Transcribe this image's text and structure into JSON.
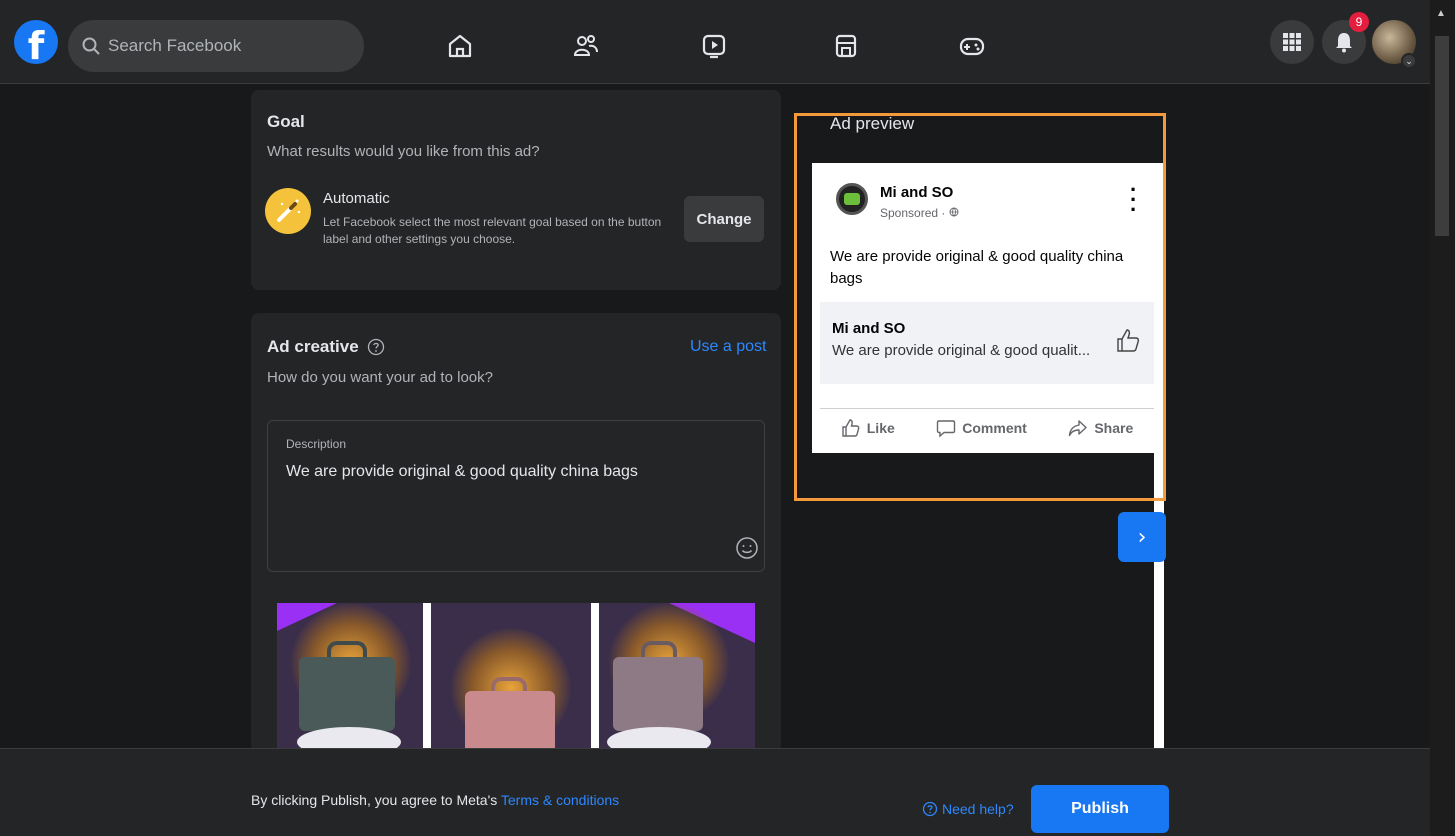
{
  "topbar": {
    "search_placeholder": "Search Facebook",
    "notification_count": "9",
    "nav_icons": [
      "home-icon",
      "friends-icon",
      "watch-icon",
      "marketplace-icon",
      "gaming-icon"
    ]
  },
  "goal": {
    "title": "Goal",
    "subtitle": "What results would you like from this ad?",
    "option_title": "Automatic",
    "option_desc": "Let Facebook select the most relevant goal based on the button label and other settings you choose.",
    "change_label": "Change"
  },
  "creative": {
    "title": "Ad creative",
    "subtitle": "How do you want your ad to look?",
    "use_post_label": "Use a post",
    "description_label": "Description",
    "description_value": "We are provide original & good quality china bags"
  },
  "preview": {
    "title": "Ad preview",
    "page_name": "Mi and SO",
    "sponsored": "Sponsored · ",
    "post_text": "We are provide original & good quality china bags",
    "link_title": "Mi and SO",
    "link_desc": "We are provide original & good qualit...",
    "actions": {
      "like": "Like",
      "comment": "Comment",
      "share": "Share"
    },
    "next_label": "›"
  },
  "footer": {
    "agree_text": "By clicking Publish, you agree to Meta's ",
    "terms_label": "Terms & conditions",
    "help_label": "Need help?",
    "publish_label": "Publish"
  },
  "colors": {
    "accent": "#1877f2",
    "highlight_frame": "#f39a3c",
    "badge": "#e41e3f"
  }
}
